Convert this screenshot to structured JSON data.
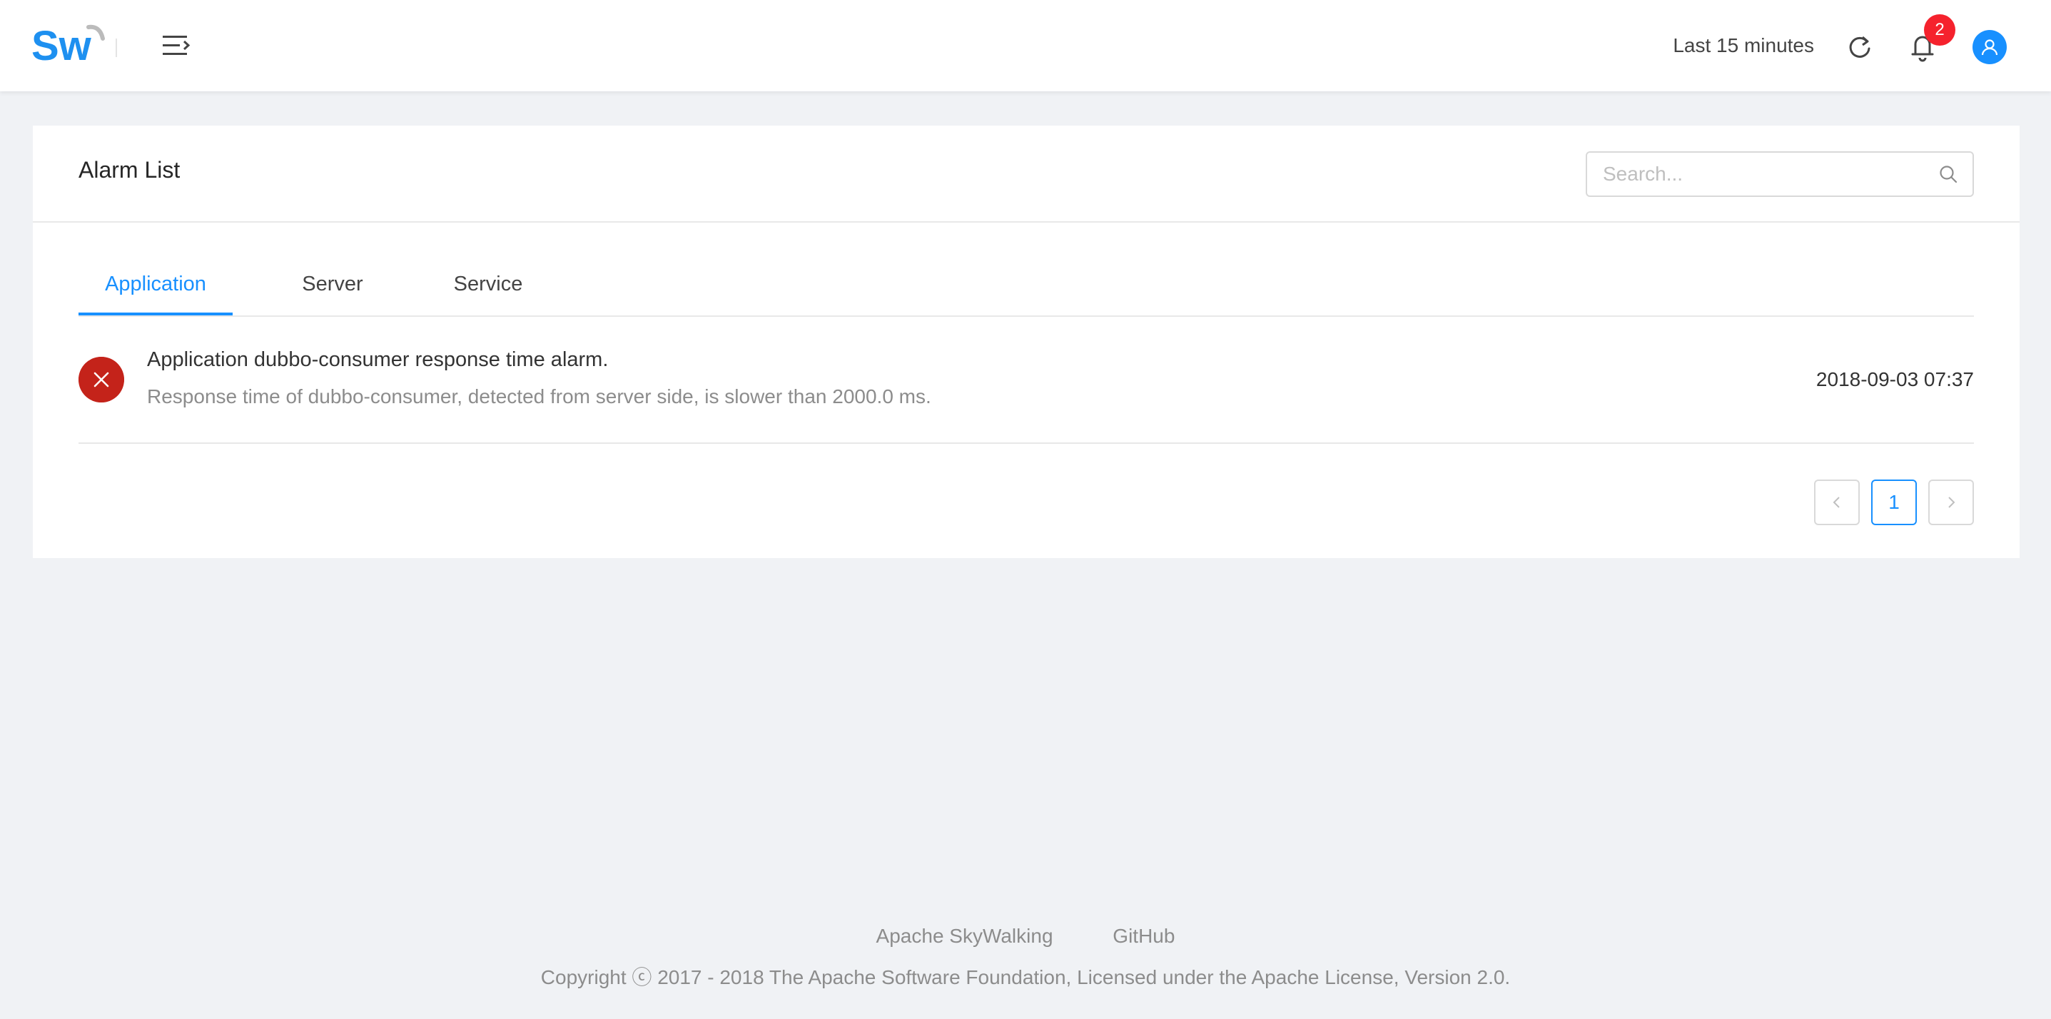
{
  "header": {
    "logo_text": "Sw",
    "time_range_label": "Last 15 minutes",
    "notification_count": "2"
  },
  "card": {
    "title": "Alarm List",
    "search": {
      "placeholder": "Search...",
      "value": ""
    }
  },
  "tabs": [
    {
      "label": "Application",
      "active": true
    },
    {
      "label": "Server",
      "active": false
    },
    {
      "label": "Service",
      "active": false
    }
  ],
  "alarms": [
    {
      "title": "Application dubbo-consumer response time alarm.",
      "description": "Response time of dubbo-consumer, detected from server side, is slower than 2000.0 ms.",
      "time": "2018-09-03 07:37",
      "status_icon": "close-circle-icon"
    }
  ],
  "pagination": {
    "current_page": "1"
  },
  "footer": {
    "links": [
      "Apache SkyWalking",
      "GitHub"
    ],
    "copyright": "Copyright ⓒ 2017 - 2018 The Apache Software Foundation, Licensed under the Apache License, Version 2.0."
  },
  "colors": {
    "accent": "#1890ff",
    "error": "#c4231a",
    "badge": "#f5222d",
    "background": "#f0f2f5"
  }
}
